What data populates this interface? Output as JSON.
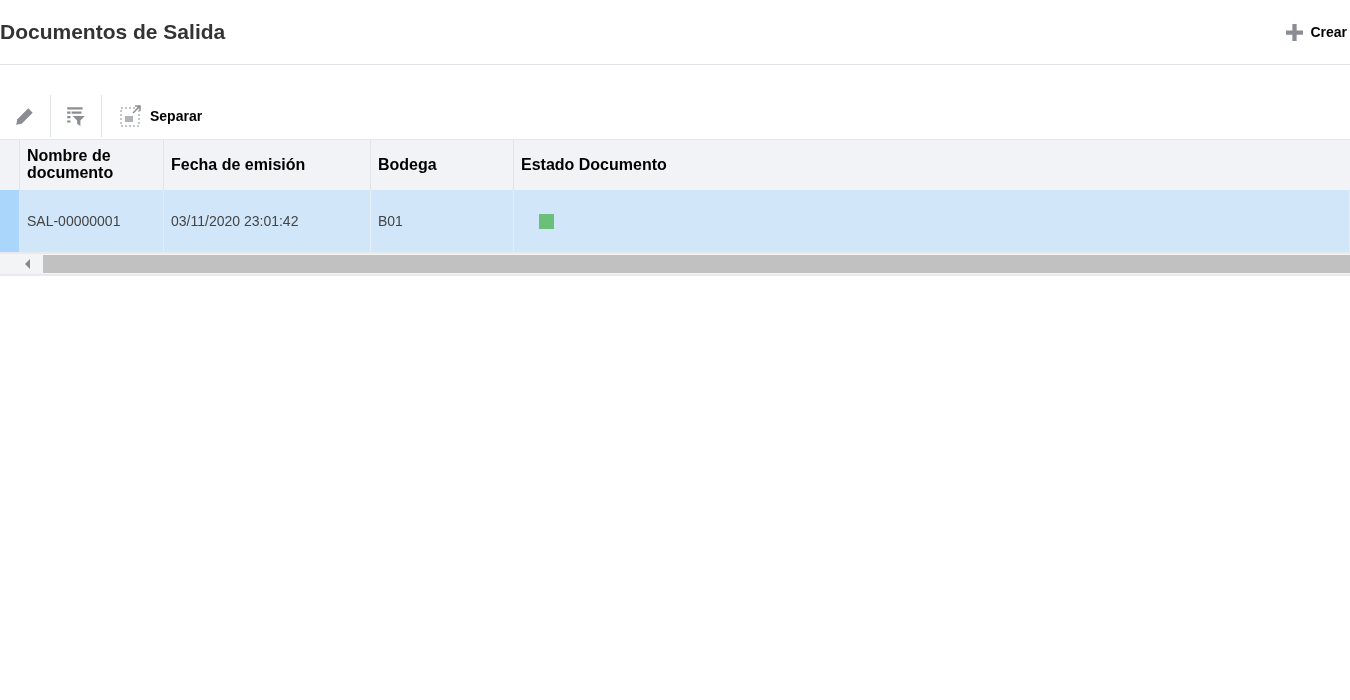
{
  "page": {
    "title": "Documentos de Salida",
    "create_button": "Crear"
  },
  "toolbar": {
    "buttons": [
      {
        "kind": "edit"
      },
      {
        "kind": "filter"
      },
      {
        "kind": "detach",
        "label": "Separar"
      }
    ]
  },
  "table": {
    "columns": [
      "Nombre de documento",
      "Fecha de emisión",
      "Bodega",
      "Estado Documento"
    ],
    "rows": [
      {
        "selected": true,
        "cells": [
          "SAL-00000001",
          "03/11/2020 23:01:42",
          "B01"
        ],
        "color": "#6abf7b"
      }
    ]
  }
}
